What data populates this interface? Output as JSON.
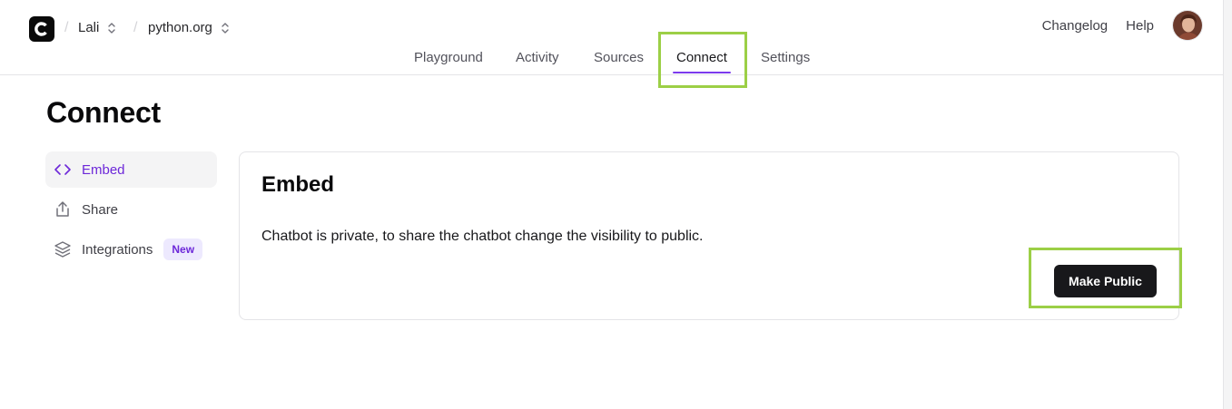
{
  "header": {
    "workspace": "Lali",
    "project": "python.org",
    "links": [
      "Changelog",
      "Help"
    ]
  },
  "tabs": [
    {
      "label": "Playground"
    },
    {
      "label": "Activity"
    },
    {
      "label": "Sources"
    },
    {
      "label": "Connect",
      "active": true
    },
    {
      "label": "Settings"
    }
  ],
  "page": {
    "title": "Connect"
  },
  "sidebar": {
    "items": [
      {
        "label": "Embed",
        "icon": "code-icon",
        "active": true
      },
      {
        "label": "Share",
        "icon": "share-icon"
      },
      {
        "label": "Integrations",
        "icon": "layers-icon",
        "badge": "New"
      }
    ]
  },
  "card": {
    "title": "Embed",
    "text": "Chatbot is private, to share the chatbot change the visibility to public.",
    "button": "Make Public"
  },
  "colors": {
    "accent": "#7c3aed",
    "highlight": "#9ccf46",
    "button": "#18181b"
  }
}
